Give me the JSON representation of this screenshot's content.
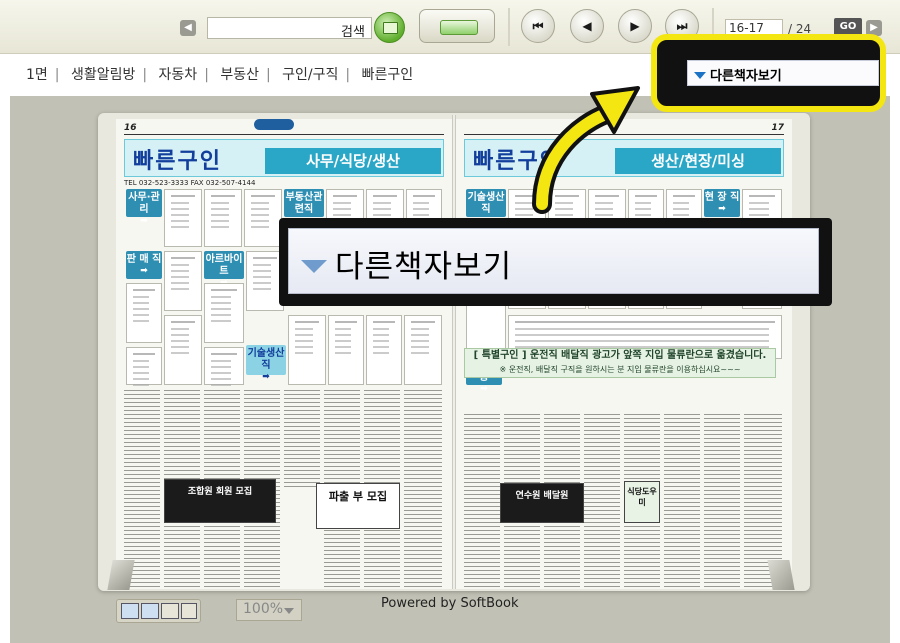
{
  "toolbar": {
    "prev_glyph": "◀",
    "next_glyph": "▶",
    "search_value": "",
    "search_label": "검색",
    "first_glyph": "⏮",
    "prev_page_glyph": "◀",
    "next_page_glyph": "▶",
    "last_glyph": "⏭",
    "page_value": "16-17",
    "page_total": "/ 24",
    "go_label": "GO"
  },
  "section_menu": {
    "items": [
      "1면",
      "생활알림방",
      "자동차",
      "부동산",
      "구인/구직",
      "빠른구인"
    ]
  },
  "callout": {
    "small_label": "다른책자보기",
    "big_label": "다른책자보기"
  },
  "pages": {
    "left_no": "16",
    "right_no": "17",
    "left_banner": "빠른구인",
    "left_sub": "사무/식당/생산",
    "right_banner": "빠른구인",
    "right_sub": "생산/현장/미싱",
    "tel": "TEL 032-523-3333 FAX 032-507-4144",
    "left_tags": [
      "사무·관리",
      "판 매 직",
      "아르바이트",
      "부동산관련직",
      "기술생산직"
    ],
    "right_tags": [
      "기술생산직",
      "현 장 직",
      "기타업종"
    ],
    "notice": "[ 특별구인 ] 운전직 배달직 광고가 앞쪽 지입 물류란으로 옮겼습니다.",
    "notice_sub": "※ 운전직, 배달직 구직을 원하시는 분 지입 물류란을 이용하십시요~~~",
    "ad_left": "조합원 회원 모집",
    "ad_center": "파출 부 모집",
    "ad_right_1": "연수원 배달원",
    "ad_right_2": "식당도우미"
  },
  "bottom": {
    "zoom_value": "100%",
    "powered_by": "Powered by SoftBook"
  },
  "colors": {
    "callout_yellow": "#f3e611",
    "banner_blue": "#123e9c",
    "banner_teal": "#2aa6c7"
  }
}
